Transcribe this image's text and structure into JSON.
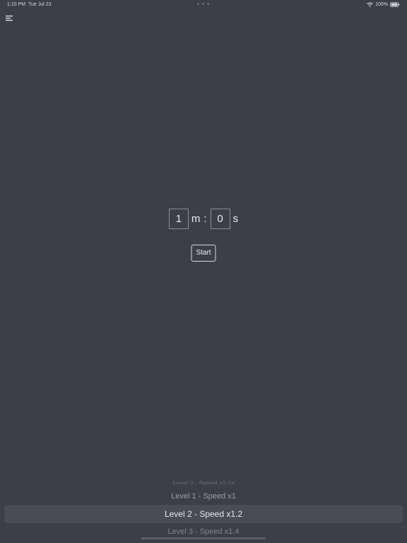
{
  "status_bar": {
    "time": "1:10 PM",
    "date": "Tue Jul 23",
    "dots": "• • •",
    "battery": "100%"
  },
  "timer": {
    "minutes": "1",
    "minutes_unit": "m",
    "separator": ":",
    "seconds": "0",
    "seconds_unit": "s"
  },
  "start_label": "Start",
  "levels": [
    "Level 0 - Speed x0.7x",
    "Level 1 - Speed x1",
    "Level 2 - Speed x1.2",
    "Level 3 - Speed x1.4"
  ],
  "selected_level": "Level 2 - Speed x1.2",
  "icons": {
    "menu": "menu-icon",
    "wifi": "wifi-icon",
    "battery": "battery-icon"
  },
  "colors": {
    "background": "#3c3f47",
    "selection": "#494c54",
    "text": "#e6e7ea"
  }
}
